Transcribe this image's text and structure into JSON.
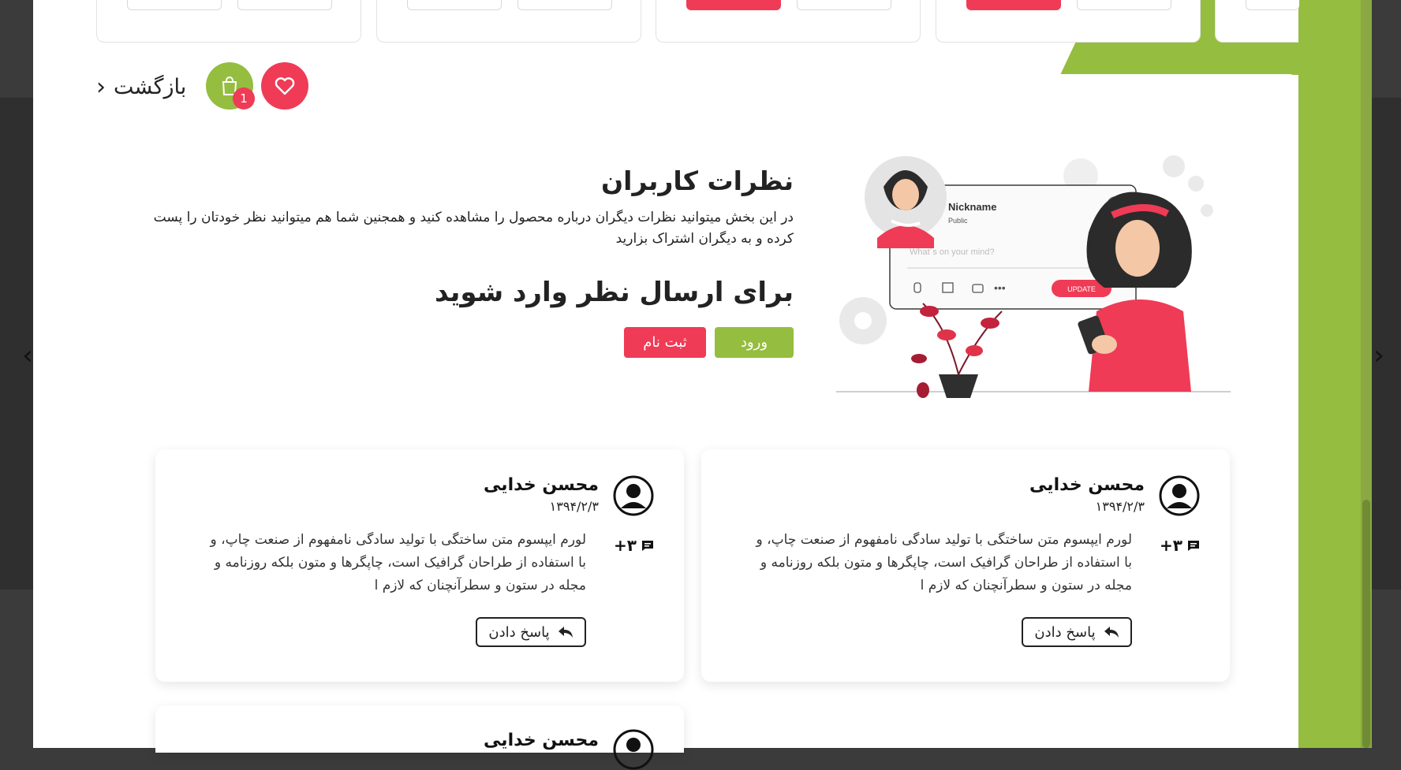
{
  "header": {
    "back_label": "بازگشت",
    "cart_count": "1"
  },
  "intro": {
    "title": "نظرات کاربران",
    "description": "در این بخش میتوانید نظرات دیگران درباره محصول را مشاهده کنید و همجنین شما هم میتوانید نظر خودتان را پست کرده و به دیگران اشتراک بزارید",
    "login_prompt": "برای ارسال نظر وارد شوید",
    "login_button": "ورود",
    "register_button": "ثبت نام"
  },
  "illustration": {
    "nickname": "Nickname",
    "visibility": "Public",
    "placeholder": "What´s on your mind?",
    "update_button": "UPDATE"
  },
  "comments": [
    {
      "author": "محسن خدایی",
      "date": "۱۳۹۴/۲/۳",
      "text": "لورم ایپسوم متن ساختگی با تولید سادگی نامفهوم از صنعت چاپ، و با استفاده از طراحان گرافیک است، چاپگرها و متون بلکه روزنامه و مجله در ستون و سطرآنچنان که لازم ا",
      "replies_count": "۳+",
      "reply_label": "پاسخ دادن"
    },
    {
      "author": "محسن خدایی",
      "date": "۱۳۹۴/۲/۳",
      "text": "لورم ایپسوم متن ساختگی با تولید سادگی نامفهوم از صنعت چاپ، و با استفاده از طراحان گرافیک است، چاپگرها و متون بلکه روزنامه و مجله در ستون و سطرآنچنان که لازم ا",
      "replies_count": "۳+",
      "reply_label": "پاسخ دادن"
    },
    {
      "author": "محسن خدایی"
    }
  ],
  "colors": {
    "accent_green": "#95bd3f",
    "accent_red": "#ef3b56"
  }
}
